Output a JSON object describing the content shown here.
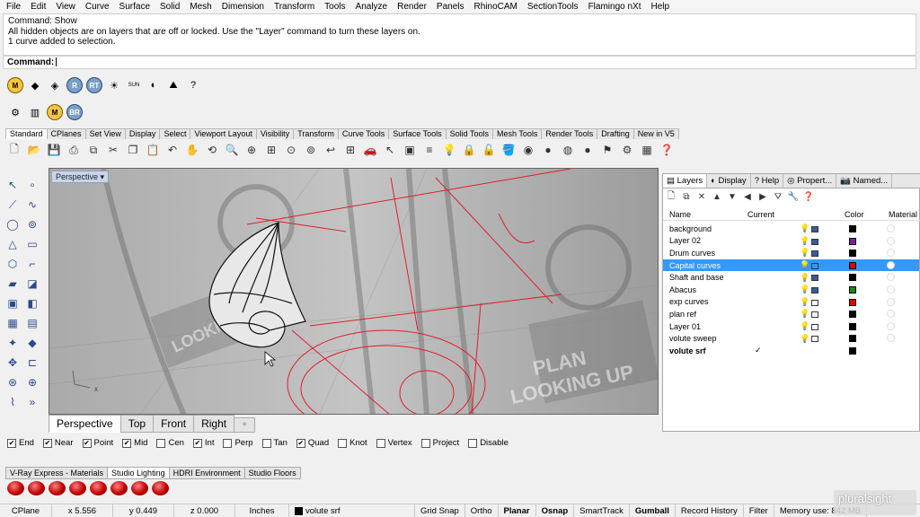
{
  "menu": [
    "File",
    "Edit",
    "View",
    "Curve",
    "Surface",
    "Solid",
    "Mesh",
    "Dimension",
    "Transform",
    "Tools",
    "Analyze",
    "Render",
    "Panels",
    "RhinoCAM",
    "SectionTools",
    "Flamingo nXt",
    "Help"
  ],
  "command_history": [
    "Command: Show",
    "All hidden objects are on layers that are off or locked.  Use the \"Layer\" command to turn these layers on.",
    "1 curve added to selection."
  ],
  "command_prompt": "Command:",
  "plugin_toolbar1": [
    {
      "icon": "M",
      "label": "M"
    },
    {
      "icon": "gem-icon",
      "label": "◆"
    },
    {
      "icon": "tag-icon",
      "label": "◈"
    },
    {
      "icon": "R",
      "label": "R"
    },
    {
      "icon": "RT",
      "label": "RT"
    },
    {
      "icon": "sun-icon",
      "label": "☀"
    },
    {
      "icon": "sun-text",
      "label": "SUN"
    },
    {
      "icon": "lamp-icon",
      "label": "◐"
    },
    {
      "icon": "landscape-icon",
      "label": "⛰"
    },
    {
      "icon": "help-icon",
      "label": "?"
    }
  ],
  "plugin_toolbar2": [
    {
      "icon": "gear-icon",
      "label": "⚙"
    },
    {
      "icon": "building-icon",
      "label": "▥"
    },
    {
      "icon": "M",
      "label": "M"
    },
    {
      "icon": "BR",
      "label": "BR"
    }
  ],
  "toolbar_tabs": [
    "Standard",
    "CPlanes",
    "Set View",
    "Display",
    "Select",
    "Viewport Layout",
    "Visibility",
    "Transform",
    "Curve Tools",
    "Surface Tools",
    "Solid Tools",
    "Mesh Tools",
    "Render Tools",
    "Drafting",
    "New in V5"
  ],
  "active_toolbar_tab": "Standard",
  "viewport": {
    "label": "Perspective",
    "tabs": [
      "Perspective",
      "Top",
      "Front",
      "Right"
    ],
    "active_tab": "Perspective",
    "add_tab": "+"
  },
  "osnaps": [
    {
      "label": "End",
      "checked": true
    },
    {
      "label": "Near",
      "checked": true
    },
    {
      "label": "Point",
      "checked": true
    },
    {
      "label": "Mid",
      "checked": true
    },
    {
      "label": "Cen",
      "checked": false
    },
    {
      "label": "Int",
      "checked": true
    },
    {
      "label": "Perp",
      "checked": false
    },
    {
      "label": "Tan",
      "checked": false
    },
    {
      "label": "Quad",
      "checked": true
    },
    {
      "label": "Knot",
      "checked": false
    },
    {
      "label": "Vertex",
      "checked": false
    },
    {
      "label": "Project",
      "checked": false
    },
    {
      "label": "Disable",
      "checked": false
    }
  ],
  "panel": {
    "tabs": [
      "Layers",
      "Display",
      "Help",
      "Propert...",
      "Named..."
    ],
    "active_tab": "Layers",
    "columns": {
      "name": "Name",
      "current": "Current",
      "color": "Color",
      "material": "Material"
    },
    "layers": [
      {
        "name": "background",
        "color": "#000000",
        "locked": true,
        "selected": false,
        "current": false
      },
      {
        "name": "Layer 02",
        "color": "#7a1fa2",
        "locked": true,
        "selected": false,
        "current": false
      },
      {
        "name": "Drum curves",
        "color": "#000000",
        "locked": true,
        "selected": false,
        "current": false
      },
      {
        "name": "Capital curves",
        "color": "#e00000",
        "locked": false,
        "selected": true,
        "current": false
      },
      {
        "name": "Shaft and base",
        "color": "#000000",
        "locked": true,
        "selected": false,
        "current": false
      },
      {
        "name": "Abacus",
        "color": "#1a8a1a",
        "locked": true,
        "selected": false,
        "current": false
      },
      {
        "name": "exp curves",
        "color": "#e00000",
        "locked": false,
        "selected": false,
        "current": false
      },
      {
        "name": "plan ref",
        "color": "#000000",
        "locked": false,
        "selected": false,
        "current": false
      },
      {
        "name": "Layer 01",
        "color": "#000000",
        "locked": false,
        "selected": false,
        "current": false
      },
      {
        "name": "volute sweep",
        "color": "#000000",
        "locked": false,
        "selected": false,
        "current": false
      },
      {
        "name": "volute srf",
        "color": "#000000",
        "locked": false,
        "selected": false,
        "current": true
      }
    ],
    "current_mark": "✓"
  },
  "bottom_tabs": [
    "V-Ray Express - Materials",
    "Studio Lighting",
    "HDRI Environment",
    "Studio Floors"
  ],
  "bottom_active": "Studio Lighting",
  "sphere_count": 8,
  "status": {
    "cplane": "CPlane",
    "x": "x 5.556",
    "y": "y 0.449",
    "z": "z 0.000",
    "units": "Inches",
    "layer": "volute srf",
    "toggles": [
      {
        "label": "Grid Snap",
        "bold": false
      },
      {
        "label": "Ortho",
        "bold": false
      },
      {
        "label": "Planar",
        "bold": true
      },
      {
        "label": "Osnap",
        "bold": true
      },
      {
        "label": "SmartTrack",
        "bold": false
      },
      {
        "label": "Gumball",
        "bold": true
      },
      {
        "label": "Record History",
        "bold": false
      },
      {
        "label": "Filter",
        "bold": false
      }
    ],
    "memory": "Memory use: 842 MB"
  },
  "watermark": "pluralsight"
}
